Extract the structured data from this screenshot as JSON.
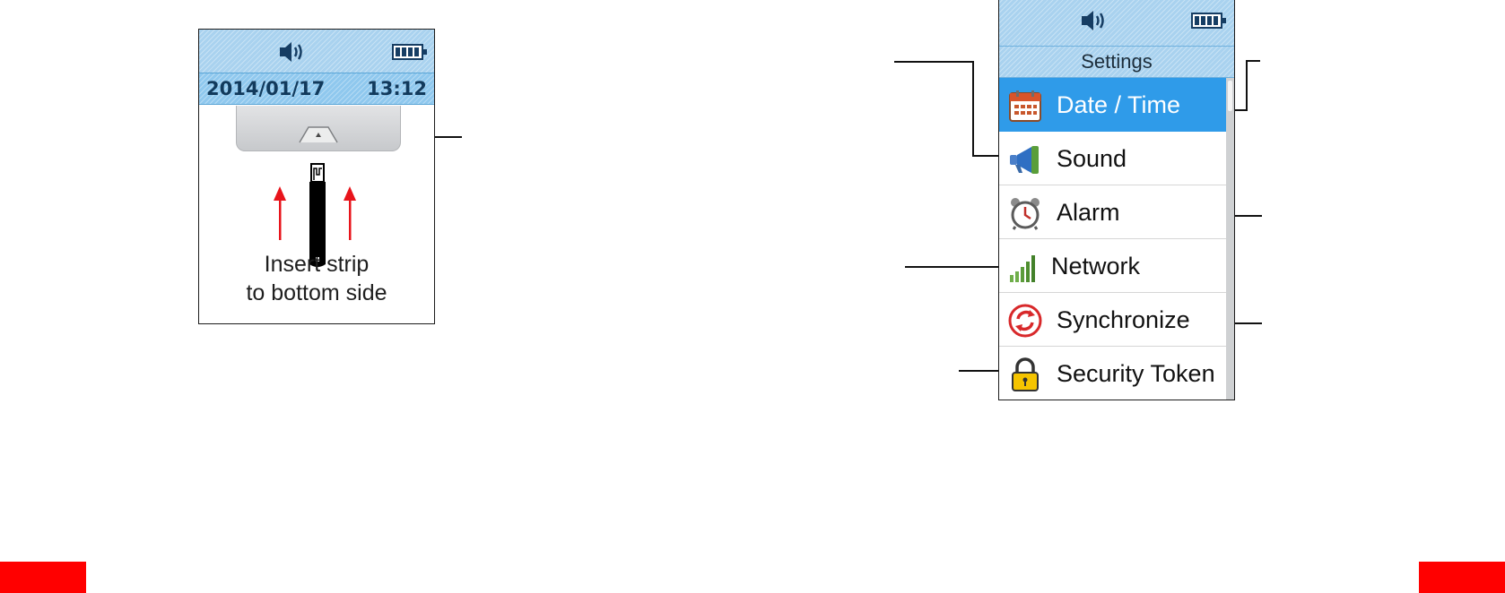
{
  "left_screen": {
    "status_icons": [
      "speaker-icon",
      "battery-icon"
    ],
    "date": "2014/01/17",
    "time": "13:12",
    "instruction_line1": "Insert strip",
    "instruction_line2": "to bottom side",
    "icons": [
      "test-port-icon",
      "test-strip-icon",
      "red-up-arrow-icon"
    ]
  },
  "right_screen": {
    "status_icons": [
      "speaker-icon",
      "battery-icon"
    ],
    "title": "Settings",
    "menu": [
      {
        "label": "Date / Time",
        "icon": "calendar-icon",
        "selected": true
      },
      {
        "label": "Sound",
        "icon": "megaphone-icon",
        "selected": false
      },
      {
        "label": "Alarm",
        "icon": "alarm-clock-icon",
        "selected": false
      },
      {
        "label": "Network",
        "icon": "signal-bars-icon",
        "selected": false
      },
      {
        "label": "Synchronize",
        "icon": "sync-icon",
        "selected": false
      },
      {
        "label": "Security Token",
        "icon": "padlock-icon",
        "selected": false
      }
    ]
  },
  "colors": {
    "header_blue": "#a9d2ef",
    "selected_blue": "#2f9be9",
    "arrow_red": "#e8141b",
    "tab_red": "#ff0000"
  }
}
